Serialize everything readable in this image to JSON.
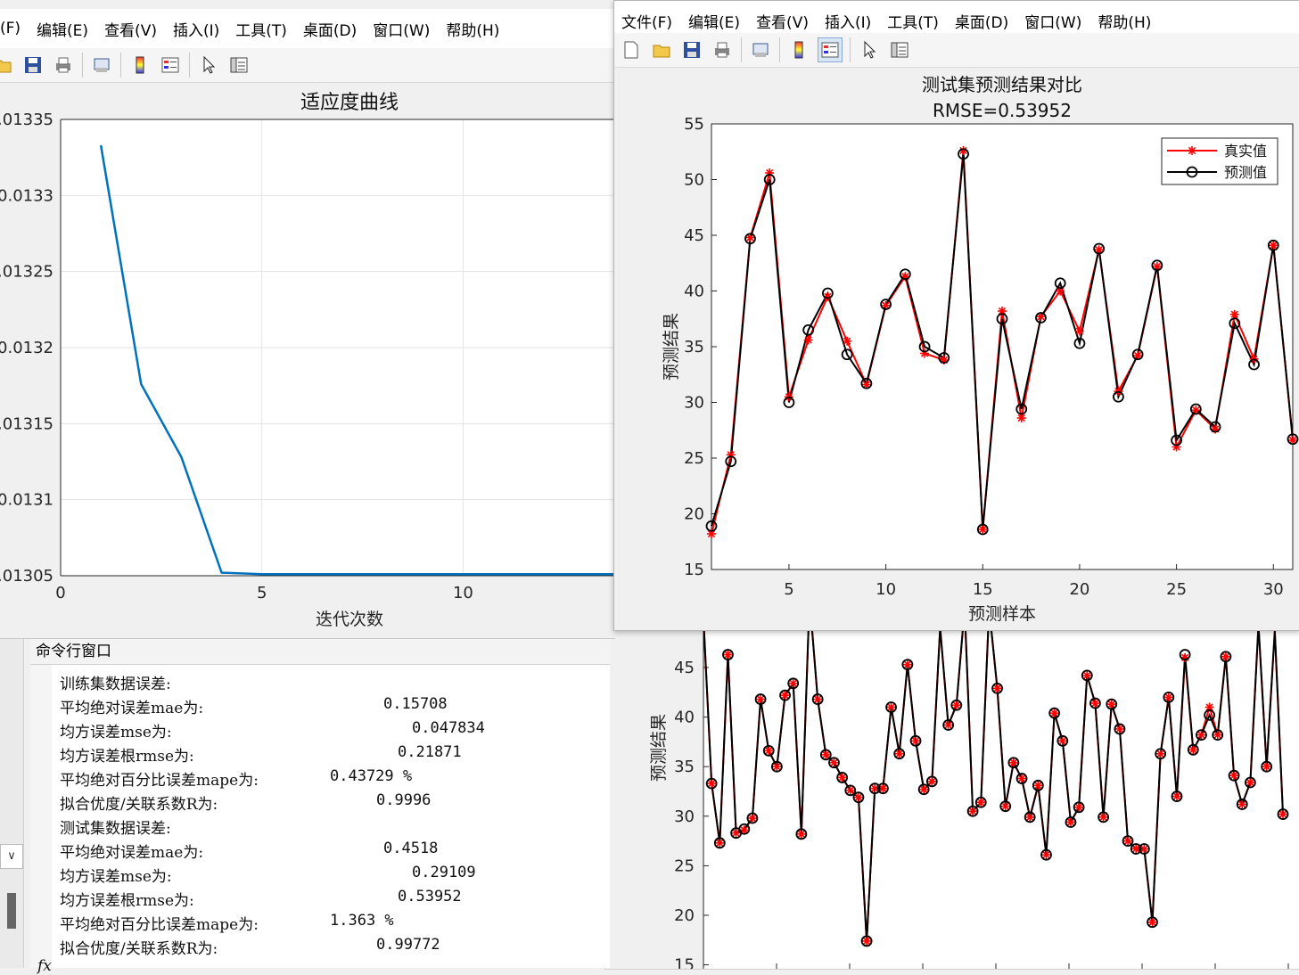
{
  "fitness_window": {
    "menu": [
      "(F)",
      "编辑(E)",
      "查看(V)",
      "插入(I)",
      "工具(T)",
      "桌面(D)",
      "窗口(W)",
      "帮助(H)"
    ],
    "chart_data": {
      "type": "line",
      "title": "适应度曲线",
      "xlabel": "迭代次数",
      "ylabel": "",
      "xlim": [
        0,
        14
      ],
      "ylim": [
        0.01305,
        0.01335
      ],
      "xticks": [
        0,
        5,
        10
      ],
      "yticks": [
        ".01335",
        "0.0133",
        ".01325",
        "0.0132",
        ".01315",
        "0.0131",
        ".01305"
      ],
      "grid": true,
      "series": [
        {
          "x": [
            1,
            2,
            3,
            4,
            5,
            6,
            7,
            8,
            9,
            10,
            11,
            12,
            13,
            14
          ],
          "values": [
            0.013333,
            0.013176,
            0.013128,
            0.013052,
            0.013051,
            0.013051,
            0.013051,
            0.013051,
            0.013051,
            0.013051,
            0.013051,
            0.013051,
            0.013051,
            0.013051
          ],
          "color": "#0072bd"
        }
      ]
    }
  },
  "test_window": {
    "menu": [
      "文件(F)",
      "编辑(E)",
      "查看(V)",
      "插入(I)",
      "工具(T)",
      "桌面(D)",
      "窗口(W)",
      "帮助(H)"
    ],
    "chart_data": {
      "type": "line",
      "title": "测试集预测结果对比",
      "subtitle": "RMSE=0.53952",
      "xlabel": "预测样本",
      "ylabel": "预测结果",
      "xlim": [
        1,
        31
      ],
      "ylim": [
        15,
        55
      ],
      "xticks": [
        5,
        10,
        15,
        20,
        25,
        30
      ],
      "yticks": [
        15,
        20,
        25,
        30,
        35,
        40,
        45,
        50,
        55
      ],
      "legend_position": "top-right",
      "series": [
        {
          "name": "真实值",
          "color": "#ff0000",
          "marker": "*",
          "values": [
            18.2,
            25.3,
            44.8,
            50.6,
            30.5,
            35.6,
            39.5,
            35.5,
            31.6,
            38.7,
            41.3,
            34.4,
            33.8,
            52.6,
            18.6,
            38.2,
            28.6,
            37.7,
            40.0,
            36.4,
            43.7,
            31.0,
            34.2,
            42.2,
            26.0,
            29.3,
            27.6,
            37.9,
            33.9,
            44.1,
            26.6
          ]
        },
        {
          "name": "预测值",
          "color": "#000000",
          "marker": "o",
          "values": [
            18.9,
            24.7,
            44.7,
            50.0,
            30.0,
            36.5,
            39.8,
            34.3,
            31.7,
            38.8,
            41.5,
            35.0,
            34.0,
            52.3,
            18.6,
            37.5,
            29.4,
            37.6,
            40.7,
            35.3,
            43.8,
            30.5,
            34.3,
            42.3,
            26.6,
            29.4,
            27.8,
            37.1,
            33.4,
            44.1,
            26.7
          ]
        }
      ]
    }
  },
  "train_window": {
    "chart_data": {
      "type": "line",
      "ylabel": "预测结果",
      "yticks": [
        15,
        20,
        25,
        30,
        35,
        40,
        45
      ],
      "ylim": [
        15,
        50
      ],
      "series": [
        {
          "color": "#ff0000",
          "marker": "*",
          "values": [
            50,
            33.3,
            27.3,
            46.3,
            28.3,
            28.6,
            29.8,
            41.8,
            36.6,
            35.0,
            42.2,
            43.4,
            28.2,
            52,
            41.8,
            36.2,
            35.4,
            33.9,
            32.6,
            31.9,
            17.4,
            32.8,
            32.8,
            41.0,
            36.3,
            45.3,
            37.6,
            32.7,
            33.5,
            49.0,
            39.2,
            41.2,
            51,
            30.5,
            31.4,
            51,
            42.9,
            31.0,
            35.4,
            33.8,
            29.9,
            33.1,
            26.1,
            40.4,
            37.6,
            29.4,
            30.9,
            44.2,
            41.4,
            29.9,
            41.3,
            38.8,
            27.5,
            26.7,
            26.7,
            19.3,
            36.3,
            42.0,
            32.0,
            46.0,
            36.7,
            38.2,
            41.0,
            38.2,
            46.1,
            34.1,
            31.2,
            33.4,
            49.3,
            35.0,
            48.7,
            30.2
          ]
        },
        {
          "color": "#000000",
          "marker": "o",
          "values": [
            50,
            33.3,
            27.3,
            46.3,
            28.3,
            28.7,
            29.8,
            41.8,
            36.6,
            35.0,
            42.2,
            43.4,
            28.2,
            52,
            41.8,
            36.2,
            35.4,
            33.9,
            32.6,
            31.9,
            17.4,
            32.8,
            32.8,
            41.0,
            36.3,
            45.3,
            37.6,
            32.7,
            33.5,
            49.0,
            39.2,
            41.2,
            51,
            30.5,
            31.4,
            51,
            42.9,
            31.0,
            35.4,
            33.8,
            29.9,
            33.1,
            26.1,
            40.4,
            37.6,
            29.4,
            30.9,
            44.2,
            41.4,
            29.9,
            41.3,
            38.8,
            27.5,
            26.7,
            26.7,
            19.3,
            36.3,
            42.0,
            32.0,
            46.3,
            36.7,
            38.2,
            40.2,
            38.2,
            46.1,
            34.1,
            31.2,
            33.4,
            49.3,
            35.0,
            48.7,
            30.2
          ]
        }
      ]
    }
  },
  "command_window": {
    "title": "命令行窗口",
    "lines": [
      {
        "label": "训练集数据误差:",
        "value": ""
      },
      {
        "label": "平均绝对误差mae为:",
        "value": "0.15708"
      },
      {
        "label": "均方误差mse为:",
        "value": "0.047834"
      },
      {
        "label": "均方误差根rmse为:",
        "value": "0.21871"
      },
      {
        "label": "平均绝对百分比误差mape为:",
        "value": "0.43729 %"
      },
      {
        "label": "拟合优度/关联系数R为:",
        "value": "0.9996"
      },
      {
        "label": "测试集数据误差:",
        "value": ""
      },
      {
        "label": "平均绝对误差mae为:",
        "value": "0.4518"
      },
      {
        "label": "均方误差mse为:",
        "value": "0.29109"
      },
      {
        "label": "均方误差根rmse为:",
        "value": "0.53952"
      },
      {
        "label": "平均绝对百分比误差mape为:",
        "value": "1.363 %"
      },
      {
        "label": "拟合优度/关联系数R为:",
        "value": "0.99772"
      }
    ],
    "prompt": "fx"
  }
}
